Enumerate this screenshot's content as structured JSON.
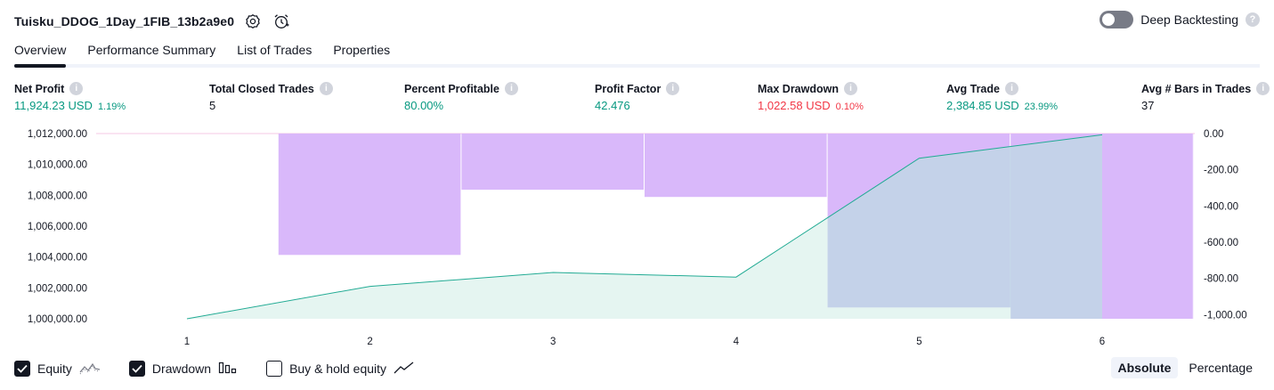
{
  "header": {
    "strategy_name": "Tuisku_DDOG_1Day_1FIB_13b2a9e0",
    "deep_backtesting_label": "Deep Backtesting",
    "deep_backtesting_enabled": false
  },
  "tabs": [
    {
      "label": "Overview",
      "active": true
    },
    {
      "label": "Performance Summary",
      "active": false
    },
    {
      "label": "List of Trades",
      "active": false
    },
    {
      "label": "Properties",
      "active": false
    }
  ],
  "metrics": {
    "net_profit": {
      "label": "Net Profit",
      "value": "11,924.23 USD",
      "pct": "1.19%"
    },
    "total_closed_trades": {
      "label": "Total Closed Trades",
      "value": "5"
    },
    "percent_profitable": {
      "label": "Percent Profitable",
      "value": "80.00%"
    },
    "profit_factor": {
      "label": "Profit Factor",
      "value": "42.476"
    },
    "max_drawdown": {
      "label": "Max Drawdown",
      "value": "1,022.58 USD",
      "pct": "0.10%"
    },
    "avg_trade": {
      "label": "Avg Trade",
      "value": "2,384.85 USD",
      "pct": "23.99%"
    },
    "avg_bars": {
      "label": "Avg # Bars in Trades",
      "value": "37"
    }
  },
  "chart_data": {
    "type": "line",
    "x": [
      1,
      2,
      3,
      4,
      5,
      6
    ],
    "xticks": [
      "1",
      "2",
      "3",
      "4",
      "5",
      "6"
    ],
    "series": [
      {
        "name": "Equity",
        "axis": "left",
        "values": [
          1000000,
          1002100,
          1003000,
          1002700,
          1010400,
          1011924
        ]
      },
      {
        "name": "Drawdown",
        "axis": "right",
        "type": "bar",
        "values": [
          -670,
          -310,
          -350,
          -960,
          -1022.58,
          -1022.58
        ]
      }
    ],
    "left_axis": {
      "ticks": [
        "1,012,000.00",
        "1,010,000.00",
        "1,008,000.00",
        "1,006,000.00",
        "1,004,000.00",
        "1,002,000.00",
        "1,000,000.00"
      ],
      "min": 1000000,
      "max": 1012000
    },
    "right_axis": {
      "ticks": [
        "0.00",
        "-200.00",
        "-400.00",
        "-600.00",
        "-800.00",
        "-1,000.00"
      ],
      "min": -1022.58,
      "max": 0
    },
    "colors": {
      "equity_line": "#22ab94",
      "equity_fill": "#e1f3ee",
      "drawdown_fill": "#d9b8fa",
      "overlap_fill": "#b8bde6"
    }
  },
  "legend": [
    {
      "label": "Equity",
      "checked": true,
      "icon": "equity-icon"
    },
    {
      "label": "Drawdown",
      "checked": true,
      "icon": "drawdown-icon"
    },
    {
      "label": "Buy & hold equity",
      "checked": false,
      "icon": "buy-hold-icon"
    }
  ],
  "modes": {
    "absolute": "Absolute",
    "percentage": "Percentage",
    "active": "absolute"
  }
}
